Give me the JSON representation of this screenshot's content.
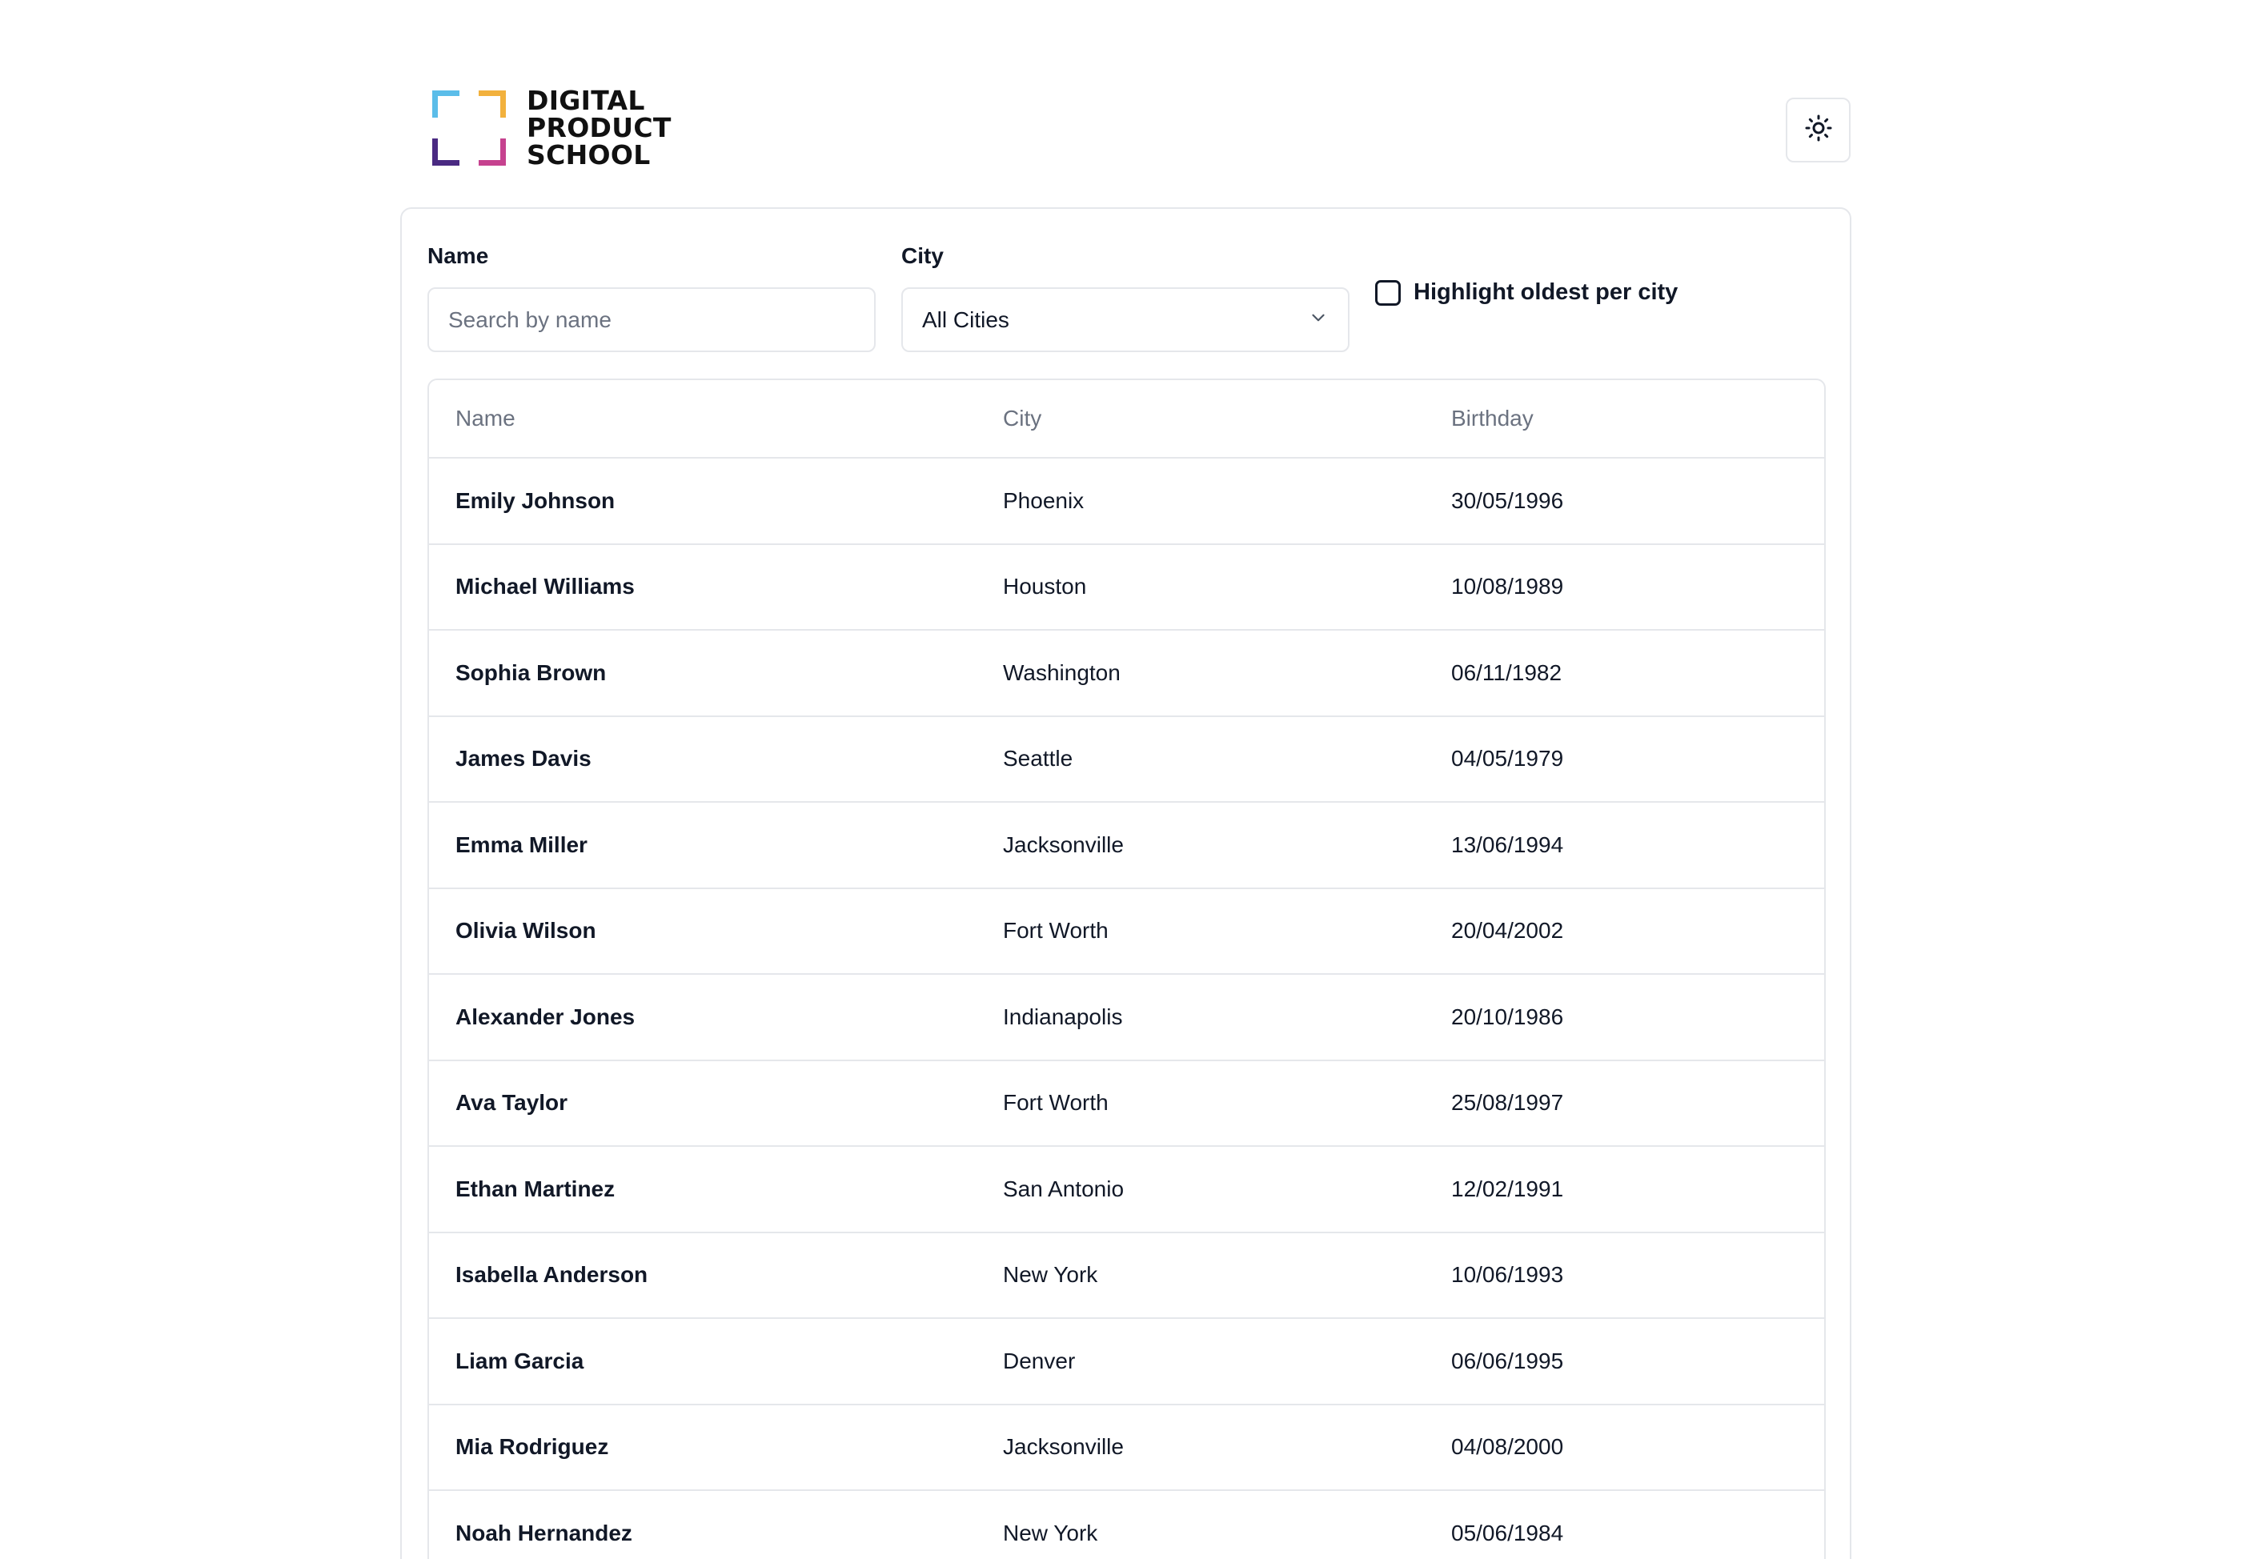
{
  "brand": {
    "lines": [
      "DIGITAL",
      "PRODUCT",
      "SCHOOL"
    ],
    "colors": {
      "top_left": "#5bbde9",
      "top_right": "#f2b13d",
      "bottom_left": "#4a2a82",
      "bottom_right": "#c6428f"
    }
  },
  "header": {
    "theme_toggle_icon": "sun-icon"
  },
  "filters": {
    "name_label": "Name",
    "name_placeholder": "Search by name",
    "name_value": "",
    "city_label": "City",
    "city_selected": "All Cities",
    "highlight_label": "Highlight oldest per city",
    "highlight_checked": false
  },
  "table": {
    "columns": [
      "Name",
      "City",
      "Birthday"
    ],
    "rows": [
      {
        "name": "Emily Johnson",
        "city": "Phoenix",
        "birthday": "30/05/1996"
      },
      {
        "name": "Michael Williams",
        "city": "Houston",
        "birthday": "10/08/1989"
      },
      {
        "name": "Sophia Brown",
        "city": "Washington",
        "birthday": "06/11/1982"
      },
      {
        "name": "James Davis",
        "city": "Seattle",
        "birthday": "04/05/1979"
      },
      {
        "name": "Emma Miller",
        "city": "Jacksonville",
        "birthday": "13/06/1994"
      },
      {
        "name": "Olivia Wilson",
        "city": "Fort Worth",
        "birthday": "20/04/2002"
      },
      {
        "name": "Alexander Jones",
        "city": "Indianapolis",
        "birthday": "20/10/1986"
      },
      {
        "name": "Ava Taylor",
        "city": "Fort Worth",
        "birthday": "25/08/1997"
      },
      {
        "name": "Ethan Martinez",
        "city": "San Antonio",
        "birthday": "12/02/1991"
      },
      {
        "name": "Isabella Anderson",
        "city": "New York",
        "birthday": "10/06/1993"
      },
      {
        "name": "Liam Garcia",
        "city": "Denver",
        "birthday": "06/06/1995"
      },
      {
        "name": "Mia Rodriguez",
        "city": "Jacksonville",
        "birthday": "04/08/2000"
      },
      {
        "name": "Noah Hernandez",
        "city": "New York",
        "birthday": "05/06/1984"
      }
    ]
  }
}
